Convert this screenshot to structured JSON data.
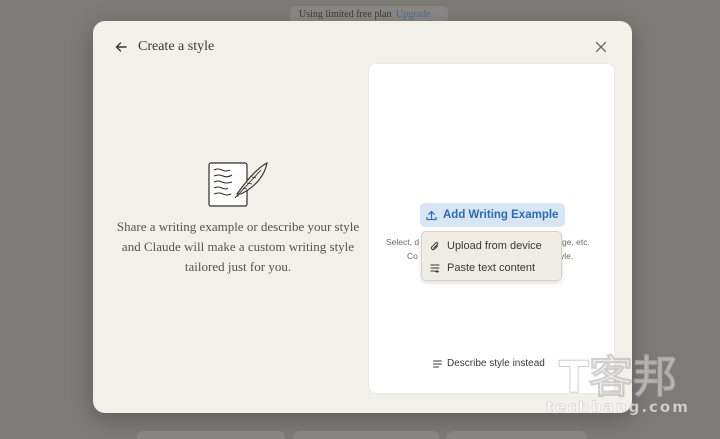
{
  "topbar": {
    "plan_text": "Using limited free plan",
    "upgrade_label": "Upgrade"
  },
  "modal": {
    "title": "Create a style",
    "description": "Share a writing example or describe your style and Claude will make a custom writing style tailored just for you."
  },
  "panel": {
    "add_button_label": "Add Writing Example",
    "hint_left_1": "Select, d",
    "hint_right_1": "sage, etc.",
    "hint_left_2": "Co",
    "hint_right_2": "yle.",
    "menu": {
      "upload_label": "Upload from device",
      "paste_label": "Paste text content"
    },
    "describe_label": "Describe style instead"
  },
  "watermark": {
    "logo_text": "T客邦",
    "site_text": "techbang.com"
  },
  "colors": {
    "accent": "#2d6bb5",
    "accent_bg": "#d8e5f5",
    "modal_bg": "#f2f0ea",
    "backdrop": "#7d7b77"
  },
  "icons": [
    "arrow-left-icon",
    "close-icon",
    "writing-illustration",
    "upload-icon",
    "paperclip-icon",
    "paste-text-icon",
    "lines-icon"
  ]
}
